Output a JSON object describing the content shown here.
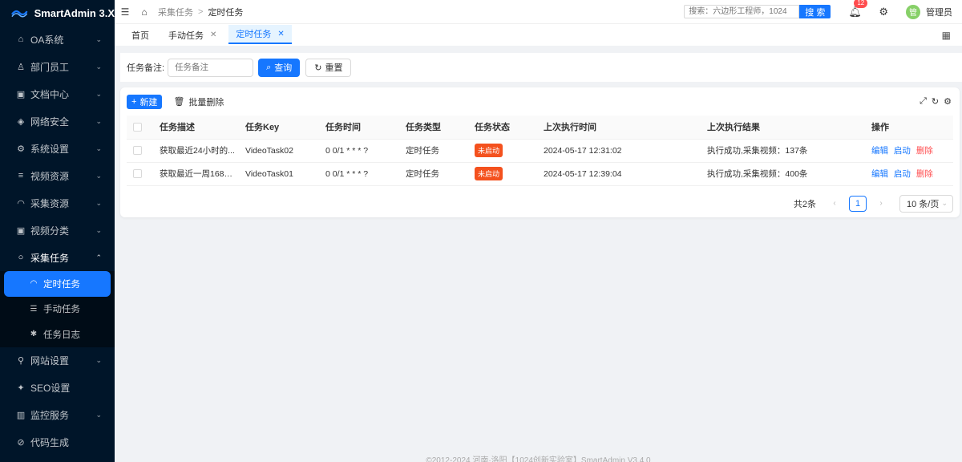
{
  "app": {
    "title": "SmartAdmin 3.X"
  },
  "sidebar": {
    "items": [
      {
        "label": "OA系统",
        "icon": "bank-icon"
      },
      {
        "label": "部门员工",
        "icon": "user-icon"
      },
      {
        "label": "文档中心",
        "icon": "file-search-icon"
      },
      {
        "label": "网络安全",
        "icon": "safety-icon"
      },
      {
        "label": "系统设置",
        "icon": "setting-icon"
      },
      {
        "label": "视频资源",
        "icon": "menu-icon"
      },
      {
        "label": "采集资源",
        "icon": "dashboard-icon"
      },
      {
        "label": "视频分类",
        "icon": "file-search-icon"
      },
      {
        "label": "采集任务",
        "icon": "bulb-icon"
      },
      {
        "label": "网站设置",
        "icon": "pushpin-icon"
      },
      {
        "label": "SEO设置",
        "icon": "twitter-icon"
      },
      {
        "label": "监控服务",
        "icon": "bar-chart-icon"
      },
      {
        "label": "代码生成",
        "icon": "code-icon"
      }
    ],
    "submenu": [
      {
        "label": "定时任务",
        "icon": "dashboard-icon"
      },
      {
        "label": "手动任务",
        "icon": "list-icon"
      },
      {
        "label": "任务日志",
        "icon": "bug-icon"
      }
    ]
  },
  "header": {
    "breadcrumb": [
      "采集任务",
      ">",
      "定时任务"
    ],
    "search_placeholder": "搜索：六边形工程师，1024",
    "search_button": "搜 索",
    "notification_count": "12",
    "avatar_text": "管",
    "username": "管理员"
  },
  "tabs": [
    {
      "label": "首页",
      "closable": false
    },
    {
      "label": "手动任务",
      "closable": true
    },
    {
      "label": "定时任务",
      "closable": true,
      "active": true
    }
  ],
  "query": {
    "label": "任务备注:",
    "placeholder": "任务备注",
    "search_button": "查询",
    "reset_button": "重置"
  },
  "toolbar": {
    "new_button": "新建",
    "batch_delete": "批量删除"
  },
  "table": {
    "columns": [
      "任务描述",
      "任务Key",
      "任务时间",
      "任务类型",
      "任务状态",
      "上次执行时间",
      "上次执行结果",
      "操作"
    ],
    "rows": [
      {
        "desc": "获取最近24小时的...",
        "key": "VideoTask02",
        "cron": "0 0/1 * * * ?",
        "type": "定时任务",
        "status": "未启动",
        "last_time": "2024-05-17 12:31:02",
        "last_result": "执行成功,采集视频：137条",
        "actions": [
          "编辑",
          "启动",
          "删除"
        ]
      },
      {
        "desc": "获取最近一周168小...",
        "key": "VideoTask01",
        "cron": "0 0/1 * * * ?",
        "type": "定时任务",
        "status": "未启动",
        "last_time": "2024-05-17 12:39:04",
        "last_result": "执行成功,采集视频：400条",
        "actions": [
          "编辑",
          "启动",
          "删除"
        ]
      }
    ]
  },
  "pagination": {
    "total": "共2条",
    "current": "1",
    "page_size": "10 条/页"
  },
  "footer": "©2012-2024 河南·洛阳【1024创新实验室】SmartAdmin V3.4.0",
  "colors": {
    "primary": "#1677ff",
    "sidebar": "#001529",
    "danger": "#ff4d4f",
    "tag": "#f4511e"
  }
}
